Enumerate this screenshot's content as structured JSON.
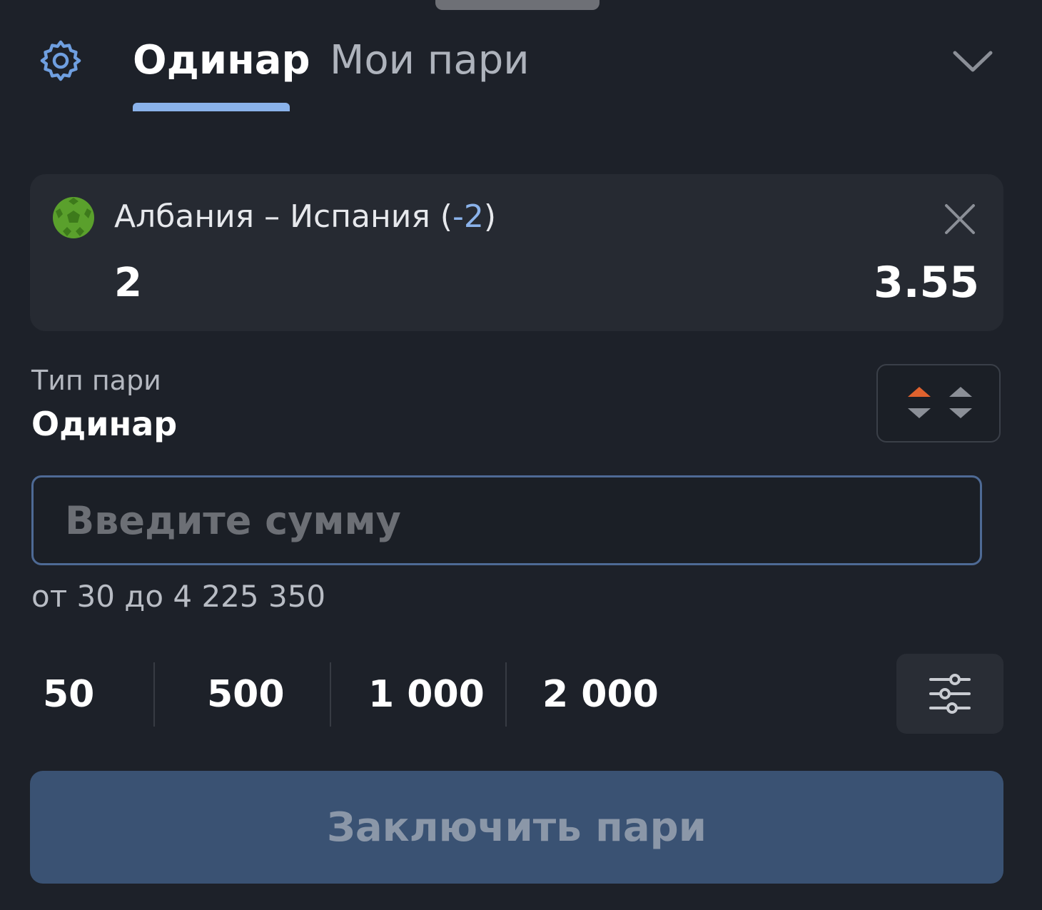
{
  "header": {
    "tabs": [
      "Одинар",
      "Мои пари"
    ],
    "active_tab": 0
  },
  "event": {
    "title": "Албания – Испания (",
    "handicap": "-2",
    "title_close": ")",
    "outcome": "2",
    "odds": "3.55",
    "sport_icon": "football-icon"
  },
  "bet_type": {
    "label": "Тип пари",
    "value": "Одинар"
  },
  "amount": {
    "placeholder": "Введите сумму",
    "value": "",
    "range": "от 30 до 4 225 350"
  },
  "quick_amounts": [
    "50",
    "500",
    "1 000",
    "2 000"
  ],
  "submit_label": "Заключить пари",
  "colors": {
    "background": "#1d2129",
    "card": "#262a32",
    "accent_blue": "#8ab2ea",
    "odds_up": "#e0622e",
    "ball_green": "#5aa02c",
    "submit_bg": "#3a5273"
  }
}
